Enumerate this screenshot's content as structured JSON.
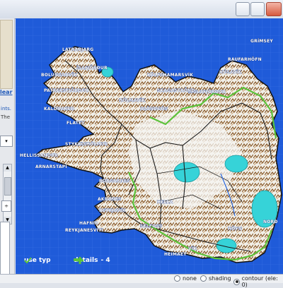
{
  "sidebar": {
    "clear_link": "lear",
    "text_line1": "ints.",
    "text_line2": "The",
    "dropdown_arrow": "▾",
    "spinner_label": "÷"
  },
  "map": {
    "places": [
      {
        "name": "LATRABJARG"
      },
      {
        "name": "ÍSAFJÖRÐUR"
      },
      {
        "name": "PATREKSFJÖRÐUR"
      },
      {
        "name": "BOLUNGARVÍK"
      },
      {
        "name": "SIGLUFJÖRÐUR"
      },
      {
        "name": "KALDBAKUR"
      },
      {
        "name": "KÁLFSHAMARSVÍK"
      },
      {
        "name": "SKAGASTRÖND"
      },
      {
        "name": "HÚSAVÍK"
      },
      {
        "name": "RAUFARHÖFN"
      },
      {
        "name": "GRÍMSEY"
      },
      {
        "name": "HÓLMAVÍK"
      },
      {
        "name": "BLÖNDUÓS"
      },
      {
        "name": "FLATEY"
      },
      {
        "name": "STYKKISHÓLMUR"
      },
      {
        "name": "HELLISSANDUR"
      },
      {
        "name": "ARNARSTAPI"
      },
      {
        "name": "BORGARNES"
      },
      {
        "name": "AKRANES"
      },
      {
        "name": "REYKJAVÍK"
      },
      {
        "name": "HAFNIR"
      },
      {
        "name": "REYKJANESVITI"
      },
      {
        "name": "HELLA"
      },
      {
        "name": "SELFOSS"
      },
      {
        "name": "HEIMAEY"
      },
      {
        "name": "HÖFN"
      },
      {
        "name": "NORÐ"
      },
      {
        "name": "VÍK"
      }
    ]
  },
  "legend": {
    "use_typ": "use typ",
    "details": "details",
    "details_value": "- 4"
  },
  "display_mode": {
    "options": [
      "none",
      "shading",
      "contour (ele: 0)"
    ],
    "selected": "contour (ele: 0)"
  },
  "colors": {
    "sea": "#1f5bd9",
    "land": "#f2f2f2",
    "relief": "#8a5a2a",
    "roads": "#222222",
    "green_track": "#5cc23a",
    "glacier": "#36d3d8"
  }
}
